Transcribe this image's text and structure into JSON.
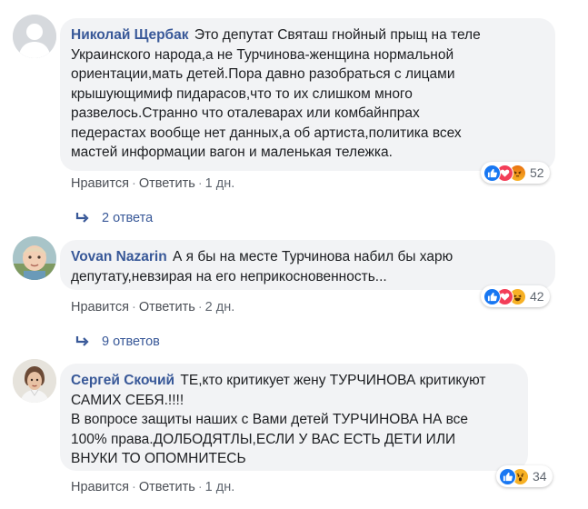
{
  "comments": [
    {
      "author": "Николай Щербак",
      "text_lines": [
        "Это депутат Святаш гнойный прыщ на теле",
        "Украинского народа,а не Турчинова-женщина нормальной",
        "ориентации,мать детей.Пора давно разобраться с лицами",
        "крышующимиф пидарасов,что то их слишком много",
        "развелось.Странно что оталеварах или комбайнпрах",
        "педерастах вообще нет данных,а об артиста,политика всех",
        "мастей информации вагон и маленькая тележка."
      ],
      "like_label": "Нравится",
      "reply_label": "Ответить",
      "time": "1 дн.",
      "reaction_icons": [
        "like-reaction-icon",
        "love-reaction-icon",
        "angry-reaction-icon"
      ],
      "reaction_count": "52",
      "replies_label": "2 ответа"
    },
    {
      "author": "Vovan Nazarin",
      "text_lines": [
        "А я бы на месте Турчинова набил бы харю",
        "депутату,невзирая на его неприкосновенность..."
      ],
      "like_label": "Нравится",
      "reply_label": "Ответить",
      "time": "2 дн.",
      "reaction_icons": [
        "like-reaction-icon",
        "love-reaction-icon",
        "haha-reaction-icon"
      ],
      "reaction_count": "42",
      "replies_label": "9 ответов"
    },
    {
      "author": "Сергей Скочий",
      "text_lines": [
        "ТЕ,кто критикует жену ТУРЧИНОВА критикуют",
        "САМИХ СЕБЯ.!!!!",
        "В вопросе защиты наших с Вами детей ТУРЧИНОВА НА все",
        "100% права.ДОЛБОДЯТЛЫ,ЕСЛИ У ВАС ЕСТЬ ДЕТИ ИЛИ",
        "ВНУКИ ТО ОПОМНИТЕСЬ"
      ],
      "like_label": "Нравится",
      "reply_label": "Ответить",
      "time": "1 дн.",
      "reaction_icons": [
        "like-reaction-icon",
        "wow-reaction-icon"
      ],
      "reaction_count": "34"
    }
  ],
  "colors": {
    "author": "#385898",
    "bubble": "#f2f3f5",
    "meta": "#606770",
    "like": "#1877f2",
    "love": "#f33e58",
    "angry": "#e9710f",
    "haha": "#f7b125"
  }
}
